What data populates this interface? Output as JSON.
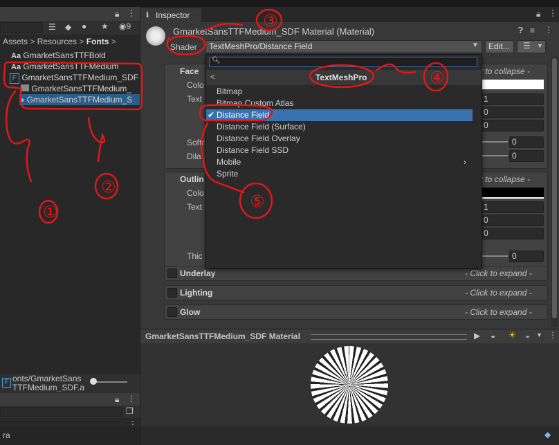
{
  "project": {
    "breadcrumb": [
      "Assets",
      "Resources",
      "Fonts"
    ],
    "hidden_count": "9",
    "items": [
      {
        "icon": "Aa",
        "label": "GmarketSansTTFBold"
      },
      {
        "icon": "Aa",
        "label": "GmarketSansTTFMedium"
      },
      {
        "icon": "F",
        "label": "GmarketSansTTFMedium_SDF"
      },
      {
        "icon": "",
        "label": "GmarketSansTTFMedium_"
      },
      {
        "icon": "●",
        "label": "GmarketSansTTFMedium_S"
      }
    ],
    "footer_path_line1": "onts/GmarketSans",
    "footer_path_line2": "TTFMedium_SDF.a",
    "console_text": "ra"
  },
  "inspector": {
    "tab_label": "Inspector",
    "material_title": "GmarketSansTTFMedium_SDF Material (Material)",
    "shader_label": "Shader",
    "shader_value": "TextMeshPro/Distance Field",
    "edit_label": "Edit...",
    "face_label": "Face",
    "face_collapse": "ck to collapse -",
    "face_color_label": "Colo",
    "face_texture_label": "Text",
    "softness_label": "Softr",
    "dilate_label": "Dila",
    "outline_label": "Outlin",
    "outline_collapse": "ck to collapse -",
    "outline_color_label": "Colo",
    "outline_texture_label": "Text",
    "thickness_label": "Thic",
    "values": {
      "v1": "1",
      "v2": "0",
      "v3": "0",
      "soft": "0",
      "dilate": "0",
      "o1": "1",
      "o2": "0",
      "o3": "0",
      "thick": "0"
    },
    "sections": [
      {
        "label": "Underlay",
        "hint": "- Click to expand -"
      },
      {
        "label": "Lighting",
        "hint": "- Click to expand -"
      },
      {
        "label": "Glow",
        "hint": "- Click to expand -"
      }
    ],
    "preview_title": "GmarketSansTTFMedium_SDF Material"
  },
  "dropdown": {
    "search_placeholder": "",
    "header": "TextMeshPro",
    "back_glyph": "<",
    "items": [
      {
        "label": "Bitmap"
      },
      {
        "label": "Bitmap Custom Atlas"
      },
      {
        "label": "Distance Field",
        "selected": true
      },
      {
        "label": "Distance Field (Surface)"
      },
      {
        "label": "Distance Field Overlay"
      },
      {
        "label": "Distance Field SSD"
      },
      {
        "label": "Mobile",
        "submenu": true
      },
      {
        "label": "Sprite"
      }
    ]
  },
  "annotations": [
    "①",
    "②",
    "③",
    "④",
    "⑤"
  ],
  "colors": {
    "selection": "#2c5d87",
    "menu_selection": "#3a72b0",
    "annotation": "#e01818"
  }
}
